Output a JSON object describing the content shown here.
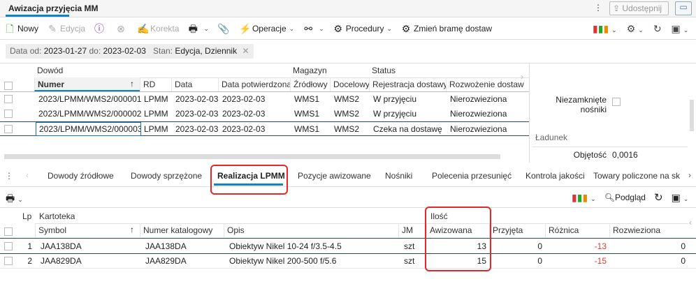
{
  "window": {
    "title": "Awizacja przyjęcia MM",
    "share_label": "Udostępnij"
  },
  "toolbar": {
    "items": [
      {
        "label": "Nowy",
        "icon": "new-document-icon",
        "enabled": true
      },
      {
        "label": "Edycja",
        "icon": "edit-document-icon",
        "enabled": false
      },
      {
        "label": "",
        "icon": "info-document-icon",
        "enabled": true
      },
      {
        "label": "",
        "icon": "delete-document-icon",
        "enabled": false
      },
      {
        "label": "Korekta",
        "icon": "correction-icon",
        "enabled": false
      },
      {
        "label": "",
        "icon": "print-icon",
        "enabled": true,
        "dropdown": true
      },
      {
        "label": "",
        "icon": "attachment-icon",
        "enabled": true
      },
      {
        "label": "Operacje",
        "icon": "operations-icon",
        "enabled": true,
        "dropdown": true
      },
      {
        "label": "",
        "icon": "relations-icon",
        "enabled": true,
        "dropdown": true
      },
      {
        "label": "Procedury",
        "icon": "procedures-icon",
        "enabled": true,
        "dropdown": true
      },
      {
        "label": "Zmień bramę dostaw",
        "icon": "change-gate-icon",
        "enabled": true
      }
    ]
  },
  "filters": {
    "date_label": "Data",
    "from_label": "od:",
    "from": "2023-01-27",
    "to_label": "do:",
    "to": "2023-02-03",
    "status_label": "Stan:",
    "status": "Edycja, Dziennik"
  },
  "grid1": {
    "groups": {
      "dowod": "Dowód",
      "magazyn": "Magazyn",
      "status": "Status"
    },
    "columns": [
      "Numer",
      "RD",
      "Data",
      "Data potwierdzona",
      "Źródłowy",
      "Docelowy",
      "Rejestracja dostawy",
      "Rozwożenie dostawy"
    ],
    "rows": [
      [
        "2023/LPMM/WMS2/000001",
        "LPMM",
        "2023-02-03",
        "2023-02-03",
        "WMS1",
        "WMS2",
        "W przyjęciu",
        "Nierozwieziona"
      ],
      [
        "2023/LPMM/WMS2/000002",
        "LPMM",
        "2023-02-03",
        "2023-02-03",
        "WMS1",
        "WMS2",
        "W przyjęciu",
        "Nierozwieziona"
      ],
      [
        "2023/LPMM/WMS2/000003",
        "LPMM",
        "2023-02-03",
        "2023-02-03",
        "WMS1",
        "WMS2",
        "Czeka na dostawę",
        "Nierozwieziona"
      ]
    ]
  },
  "side_panel": {
    "unclosed_label": "Niezamknięte",
    "unclosed_label2": "nośniki",
    "section": "Ładunek",
    "volume_label": "Objętość",
    "volume": "0,0016"
  },
  "tabs": [
    "Dowody źródłowe",
    "Dowody sprzężone",
    "Realizacja LPMM",
    "Pozycje awizowane",
    "Nośniki",
    "Polecenia przesunięć",
    "Kontrola jakości",
    "Towary policzone na sk"
  ],
  "active_tab": "Realizacja LPMM",
  "toolbar2": {
    "preview_label": "Podgląd"
  },
  "grid2": {
    "groups": {
      "kartoteka": "Kartoteka",
      "ilosc": "Ilość"
    },
    "columns": [
      "Lp",
      "Symbol",
      "Numer katalogowy",
      "Opis",
      "JM",
      "Awizowana",
      "Przyjęta",
      "Różnica",
      "Rozwieziona"
    ],
    "rows": [
      [
        "1",
        "JAA138DA",
        "JAA138DA",
        "Obiektyw Nikel 10-24 f/3.5-4.5",
        "szt",
        "13",
        "0",
        "-13",
        "0"
      ],
      [
        "2",
        "JAA829DA",
        "JAA829DA",
        "Obiektyw Nikel 200-500 f/5.6",
        "szt",
        "15",
        "0",
        "-15",
        "0"
      ]
    ]
  },
  "colors": {
    "accent": "#0a84d0",
    "highlight": "#e8262a",
    "negative": "#e53935"
  }
}
